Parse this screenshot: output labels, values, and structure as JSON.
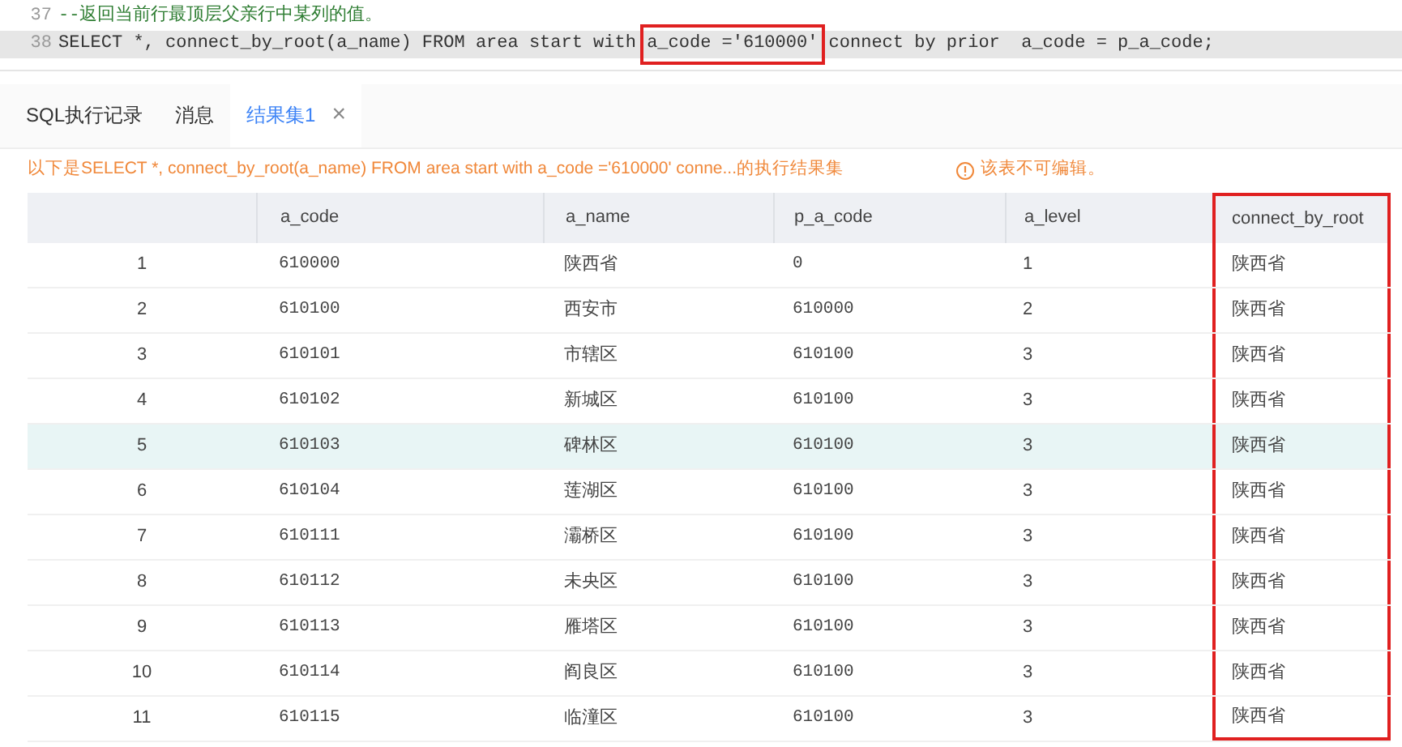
{
  "editor": {
    "lines": [
      {
        "number": "37",
        "highlighted": false,
        "tokens": [
          {
            "kind": "comment",
            "text": "--返回当前行最顶层父亲行中某列的值。"
          }
        ]
      },
      {
        "number": "38",
        "highlighted": true,
        "tokens": [
          {
            "kind": "plain",
            "text": "SELECT *, connect_by_root(a_name) FROM area start with "
          },
          {
            "kind": "boxed",
            "text": "a_code ='610000'"
          },
          {
            "kind": "plain",
            "text": " connect by prior  a_code = p_a_code;"
          }
        ]
      }
    ]
  },
  "tabs": [
    {
      "label": "SQL执行记录",
      "selected": false
    },
    {
      "label": "消息",
      "selected": false
    },
    {
      "label": "结果集1",
      "selected": true,
      "close": "×"
    }
  ],
  "message": "以下是SELECT *, connect_by_root(a_name) FROM area start with a_code ='610000' conne...的执行结果集",
  "notice": "该表不可编辑。",
  "table": {
    "columns": [
      {
        "boxed": false
      },
      {
        "label": "a_code",
        "boxed": false
      },
      {
        "label": "a_name",
        "boxed": false
      },
      {
        "label": "p_a_code",
        "boxed": false
      },
      {
        "label": "a_level",
        "boxed": false
      },
      {
        "label": "connect_by_root",
        "boxed": true
      }
    ],
    "rows": [
      {
        "selected": false,
        "cells": [
          "1",
          "610000",
          "陕西省",
          "0",
          "1",
          "陕西省"
        ]
      },
      {
        "selected": false,
        "cells": [
          "2",
          "610100",
          "西安市",
          "610000",
          "2",
          "陕西省"
        ]
      },
      {
        "selected": false,
        "cells": [
          "3",
          "610101",
          "市辖区",
          "610100",
          "3",
          "陕西省"
        ]
      },
      {
        "selected": false,
        "cells": [
          "4",
          "610102",
          "新城区",
          "610100",
          "3",
          "陕西省"
        ]
      },
      {
        "selected": true,
        "cells": [
          "5",
          "610103",
          "碑林区",
          "610100",
          "3",
          "陕西省"
        ]
      },
      {
        "selected": false,
        "cells": [
          "6",
          "610104",
          "莲湖区",
          "610100",
          "3",
          "陕西省"
        ]
      },
      {
        "selected": false,
        "cells": [
          "7",
          "610111",
          "灞桥区",
          "610100",
          "3",
          "陕西省"
        ]
      },
      {
        "selected": false,
        "cells": [
          "8",
          "610112",
          "未央区",
          "610100",
          "3",
          "陕西省"
        ]
      },
      {
        "selected": false,
        "cells": [
          "9",
          "610113",
          "雁塔区",
          "610100",
          "3",
          "陕西省"
        ]
      },
      {
        "selected": false,
        "cells": [
          "10",
          "610114",
          "阎良区",
          "610100",
          "3",
          "陕西省"
        ]
      },
      {
        "selected": false,
        "cells": [
          "11",
          "610115",
          "临潼区",
          "610100",
          "3",
          "陕西省"
        ]
      }
    ]
  }
}
